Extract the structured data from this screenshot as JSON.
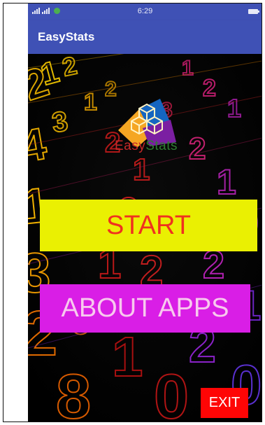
{
  "status_bar": {
    "time": "6:29",
    "signal_icons": [
      "signal-icon",
      "signal-icon",
      "wifi-icon"
    ],
    "battery_icon": "battery-icon"
  },
  "app_bar": {
    "title": "EasyStats"
  },
  "logo": {
    "icon": "cubes-icon",
    "text_part_1": "Easy",
    "text_part_2": "Stats",
    "colors": [
      "#f5a623",
      "#1565c0",
      "#7b1fa2",
      "#c62828",
      "#2e7d32"
    ]
  },
  "buttons": {
    "start_label": "START",
    "about_label": "ABOUT APPS",
    "exit_label": "EXIT"
  },
  "colors": {
    "app_bar": "#3f51b5",
    "start_bg": "#eaf002",
    "start_text": "#f0311f",
    "about_bg": "#d91ee6",
    "about_text": "#f8c9ee",
    "exit_bg": "#ff0505",
    "exit_text": "#ffffff"
  }
}
